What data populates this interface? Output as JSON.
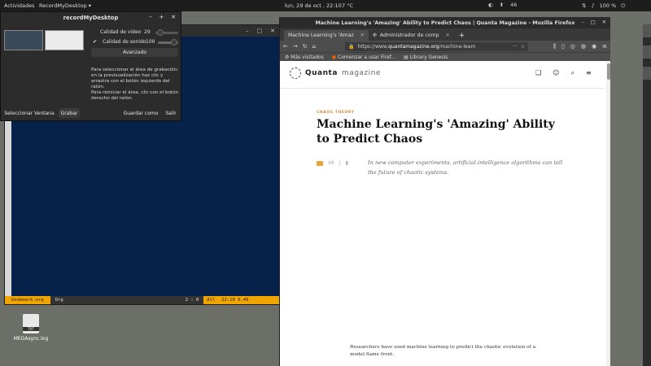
{
  "topbar": {
    "activities": "Actividades",
    "app_menu": "RecordMyDesktop ▾",
    "clock": "lun, 29 de oct , 22:10",
    "weather": "7 °C",
    "tray_value": "46",
    "battery": "100 %"
  },
  "desktop": {
    "icon_badge": "TXT",
    "icon_label": "MEGAsync.log"
  },
  "emacs": {
    "modeline": {
      "buffer": "bookmark.org",
      "mode": "Org",
      "position": "2 : 0",
      "scope": "All",
      "time": "22:10 0.49"
    }
  },
  "rmd": {
    "title": "recordMyDesktop",
    "video_label": "Calidad de video",
    "video_value": "29",
    "sound_label": "Calidad de sonido",
    "sound_value": "100",
    "sound_checked": "✔",
    "advanced": "Avanzado",
    "help1": "Para seleccionar el área de grabación: en la previsualización haz clic y arrastra con el botón izquierdo del ratón.",
    "help2": "Para reiniciar el área, clic con el botón derecho del ratón.",
    "btn_select": "Seleccionar Ventana",
    "btn_record": "Grabar",
    "btn_save": "Guardar como",
    "btn_quit": "Salir"
  },
  "firefox": {
    "window_title": "Machine Learning's 'Amazing' Ability to Predict Chaos | Quanta Magazine - Mozilla Firefox",
    "tabs": [
      {
        "label": "Machine Learning's 'Amaz"
      },
      {
        "label": "Administrador de comp"
      }
    ],
    "url_prefix": "https://www.",
    "url_domain": "quantamagazine.org",
    "url_rest": "/machine-learn",
    "bookmarks": [
      {
        "label": "Más visitados"
      },
      {
        "label": "Comenzar a usar Firef..."
      },
      {
        "label": "Library Genesis"
      }
    ]
  },
  "article": {
    "brand_a": "Quanta",
    "brand_b": "magazine",
    "kicker": "CHAOS THEORY",
    "headline": "Machine Learning's 'Amazing' Ability to Predict Chaos",
    "dek": "In new computer experiments, artificial-intelligence algorithms can tell the future of chaotic systems.",
    "comments": "48",
    "caption": "Researchers have used machine learning to predict the chaotic evolution of a model flame front."
  }
}
